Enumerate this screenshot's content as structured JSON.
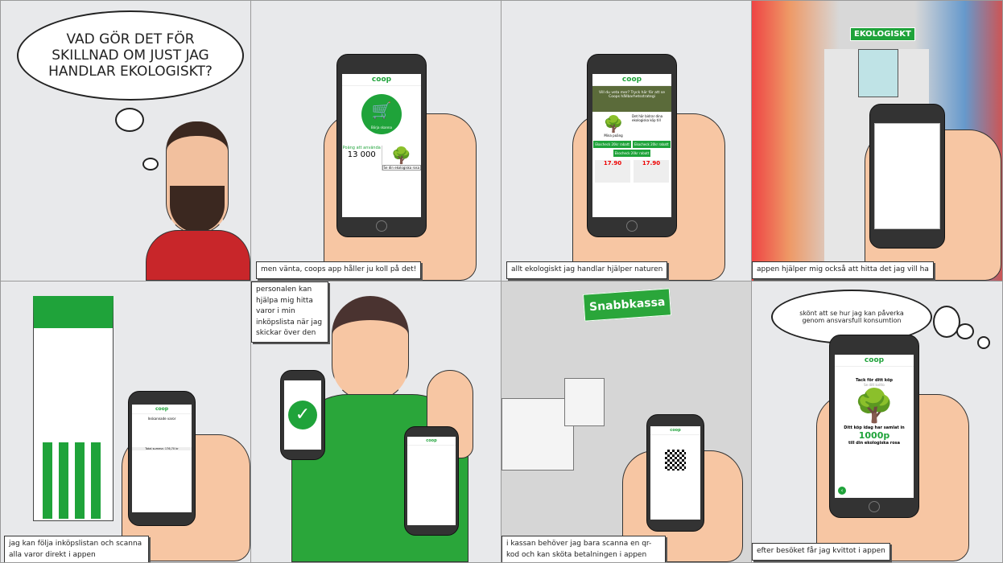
{
  "panels": [
    {
      "thought": "Vad gör det för skillnad om just jag handlar ekologiskt?"
    },
    {
      "caption": "Men vänta, Coops app håller ju koll på det!",
      "screen": {
        "logo": "coop",
        "scan_label": "Börja skanna",
        "points_label": "Poäng att använda",
        "points": "13 000",
        "tree_label": "Se din ekologiska rosa"
      }
    },
    {
      "caption": "Allt ekologiskt jag handlar hjälper naturen",
      "screen": {
        "logo": "coop",
        "banner": "Vill du veta mer? Tryck här för att se Coops hållbarhetsstrategi",
        "tree_title": "Det här bidrar dina ekologiska köp till",
        "my_points": "Mina poäng",
        "coupons": [
          "Ekocheck 20kr rabatt",
          "Ekocheck 20kr rabatt",
          "Ekocheck 20kr rabatt"
        ],
        "price": "17.90"
      }
    },
    {
      "caption": "Appen hjälper mig också att hitta det jag vill ha",
      "sign": "EKOLOGISKT"
    },
    {
      "caption": "Jag kan följa inköpslistan och scanna alla varor direkt i appen",
      "screen": {
        "logo": "coop",
        "title": "Inskannade varor",
        "total": "Total summa: 176,70 kr"
      }
    },
    {
      "caption": "Personalen kan hjälpa mig hitta varor i min inköpslista när jag skickar över den",
      "screen": {
        "logo": "coop"
      }
    },
    {
      "caption": "I kassan behöver jag bara scanna en QR-kod och kan sköta betalningen i appen",
      "sign": "Snabbkassa",
      "screen": {
        "logo": "coop"
      }
    },
    {
      "caption": "Efter besöket får jag kvittot i appen",
      "thought": "Skönt att se hur jag kan påverka genom ansvarsfull konsumtion",
      "screen": {
        "logo": "coop",
        "title": "Tack för ditt köp",
        "receipt_link": "Se ditt kvitto",
        "collected": "Ditt köp idag har samlat in",
        "points": "1000p",
        "target": "till din ekologiska rosa"
      }
    }
  ],
  "colors": {
    "green": "#1fa33a",
    "skin": "#f7c6a3",
    "panel_bg": "#e8e9eb"
  }
}
